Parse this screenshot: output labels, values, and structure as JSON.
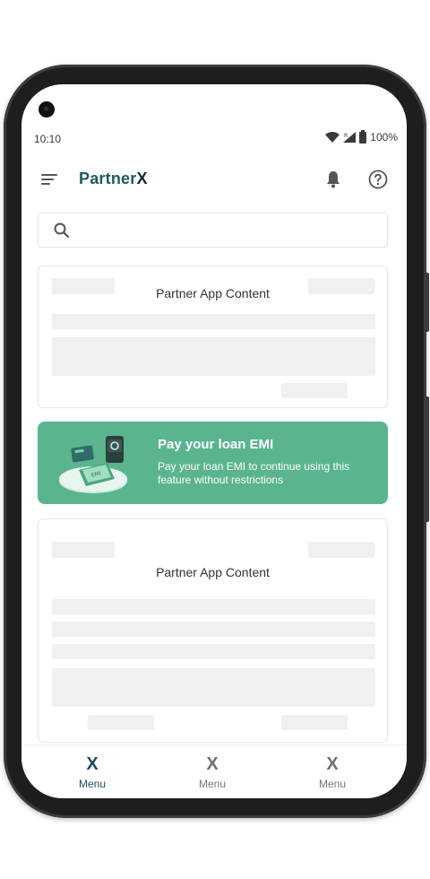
{
  "status_bar": {
    "time": "10:10",
    "battery": "100%"
  },
  "app_bar": {
    "brand_prefix": "Partner",
    "brand_suffix": "X"
  },
  "search": {
    "placeholder": ""
  },
  "cards": [
    {
      "title": "Partner App Content"
    },
    {
      "title": "Partner App Content"
    }
  ],
  "banner": {
    "title": "Pay your loan EMI",
    "text": "Pay your loan EMI to continue using this feature without restrictions",
    "color": "#5ab58e"
  },
  "bottom_nav": [
    {
      "icon": "X",
      "label": "Menu",
      "active": true
    },
    {
      "icon": "X",
      "label": "Menu",
      "active": false
    },
    {
      "icon": "X",
      "label": "Menu",
      "active": false
    }
  ],
  "colors": {
    "brand": "#1f5a5e",
    "active_nav": "#1f4e5a",
    "skeleton": "#f0f0f0"
  }
}
